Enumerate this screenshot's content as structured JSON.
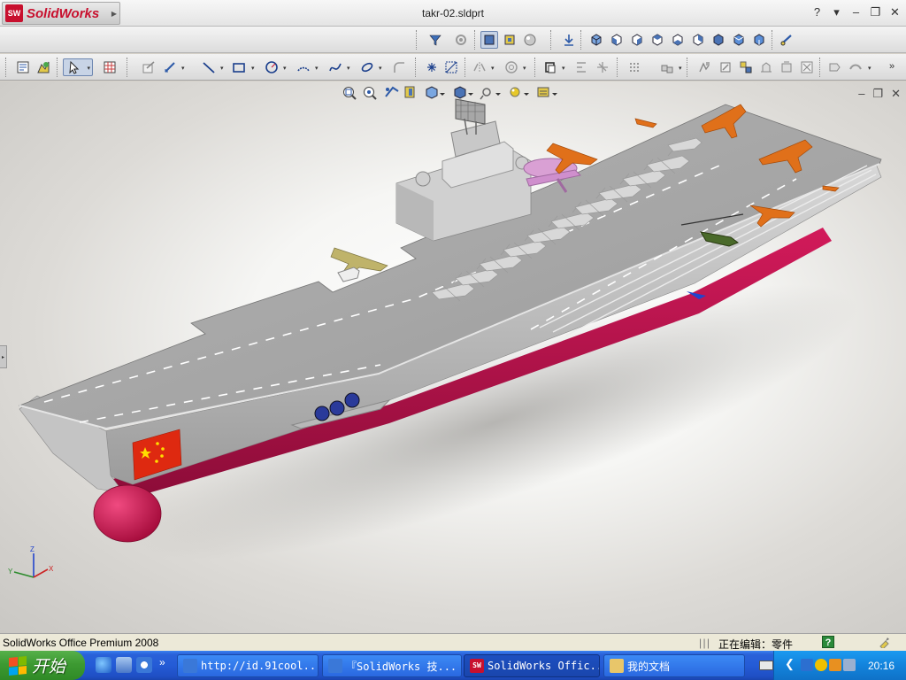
{
  "app": {
    "name": "SolidWorks",
    "logo_mark": "SW",
    "document_title": "takr-02.sldprt",
    "window_controls": [
      "?",
      "▾",
      "–",
      "❐",
      "✕"
    ]
  },
  "toolbar_top": {
    "icons": [
      "filter-icon",
      "assembly-view-icon",
      "shaded-display-icon",
      "hidden-lines-icon",
      "realview-icon",
      "normal-to-icon",
      "isometric-view-icon",
      "front-view-icon",
      "back-view-icon",
      "left-view-icon",
      "right-view-icon",
      "top-view-icon",
      "bottom-view-icon",
      "trimetric-view-icon",
      "dimetric-view-icon",
      "link-view-icon"
    ]
  },
  "toolbar_sketch": {
    "icons": [
      "properties-icon",
      "rebuild-icon",
      "select-icon",
      "grid-icon",
      "sketch-icon",
      "smart-dimension-icon",
      "line-icon",
      "rectangle-icon",
      "circle-icon",
      "arc-icon",
      "spline-icon",
      "ellipse-icon",
      "fillet-icon",
      "point-icon",
      "centerline-icon",
      "mirror-icon",
      "offset-icon",
      "trim-icon",
      "extend-icon",
      "linear-pattern-icon",
      "move-icon",
      "add-relation-icon",
      "display-relations-icon",
      "repair-icon",
      "quick-snaps-icon",
      "rapid-sketch-icon",
      "instant-3d-icon"
    ]
  },
  "viewport": {
    "heads_up_icons": [
      "zoom-fit-icon",
      "zoom-area-icon",
      "previous-view-icon",
      "section-view-icon",
      "view-orientation-icon",
      "display-style-icon",
      "hide-show-icon",
      "edit-appearance-icon",
      "scene-icon"
    ],
    "model_name": "takr-02",
    "axis_labels": {
      "x": "X",
      "y": "Y",
      "z": "Z"
    }
  },
  "statusbar": {
    "product": "SolidWorks Office Premium 2008",
    "dividers": "| | |",
    "editing": "正在编辑：零件",
    "help": "?"
  },
  "taskbar": {
    "start_label": "开始",
    "quick_launch_chevron": "»",
    "tasks": [
      {
        "label": "http://id.91cool...",
        "active": false,
        "icon_color": "#3a78d8"
      },
      {
        "label": "『SolidWorks 技...",
        "active": false,
        "icon_color": "#3a78d8"
      },
      {
        "label": "SolidWorks Offic...",
        "active": true,
        "icon_color": "#c8102e"
      },
      {
        "label": "我的文档",
        "active": false,
        "icon_color": "#e8c66a"
      }
    ],
    "clock": "20:16"
  },
  "colors": {
    "brand_red": "#c8102e",
    "deck_gray": "#a0a0a0",
    "hull_red": "#c0134a",
    "taskbar_blue": "#245bd6",
    "start_green": "#3d9a32"
  }
}
